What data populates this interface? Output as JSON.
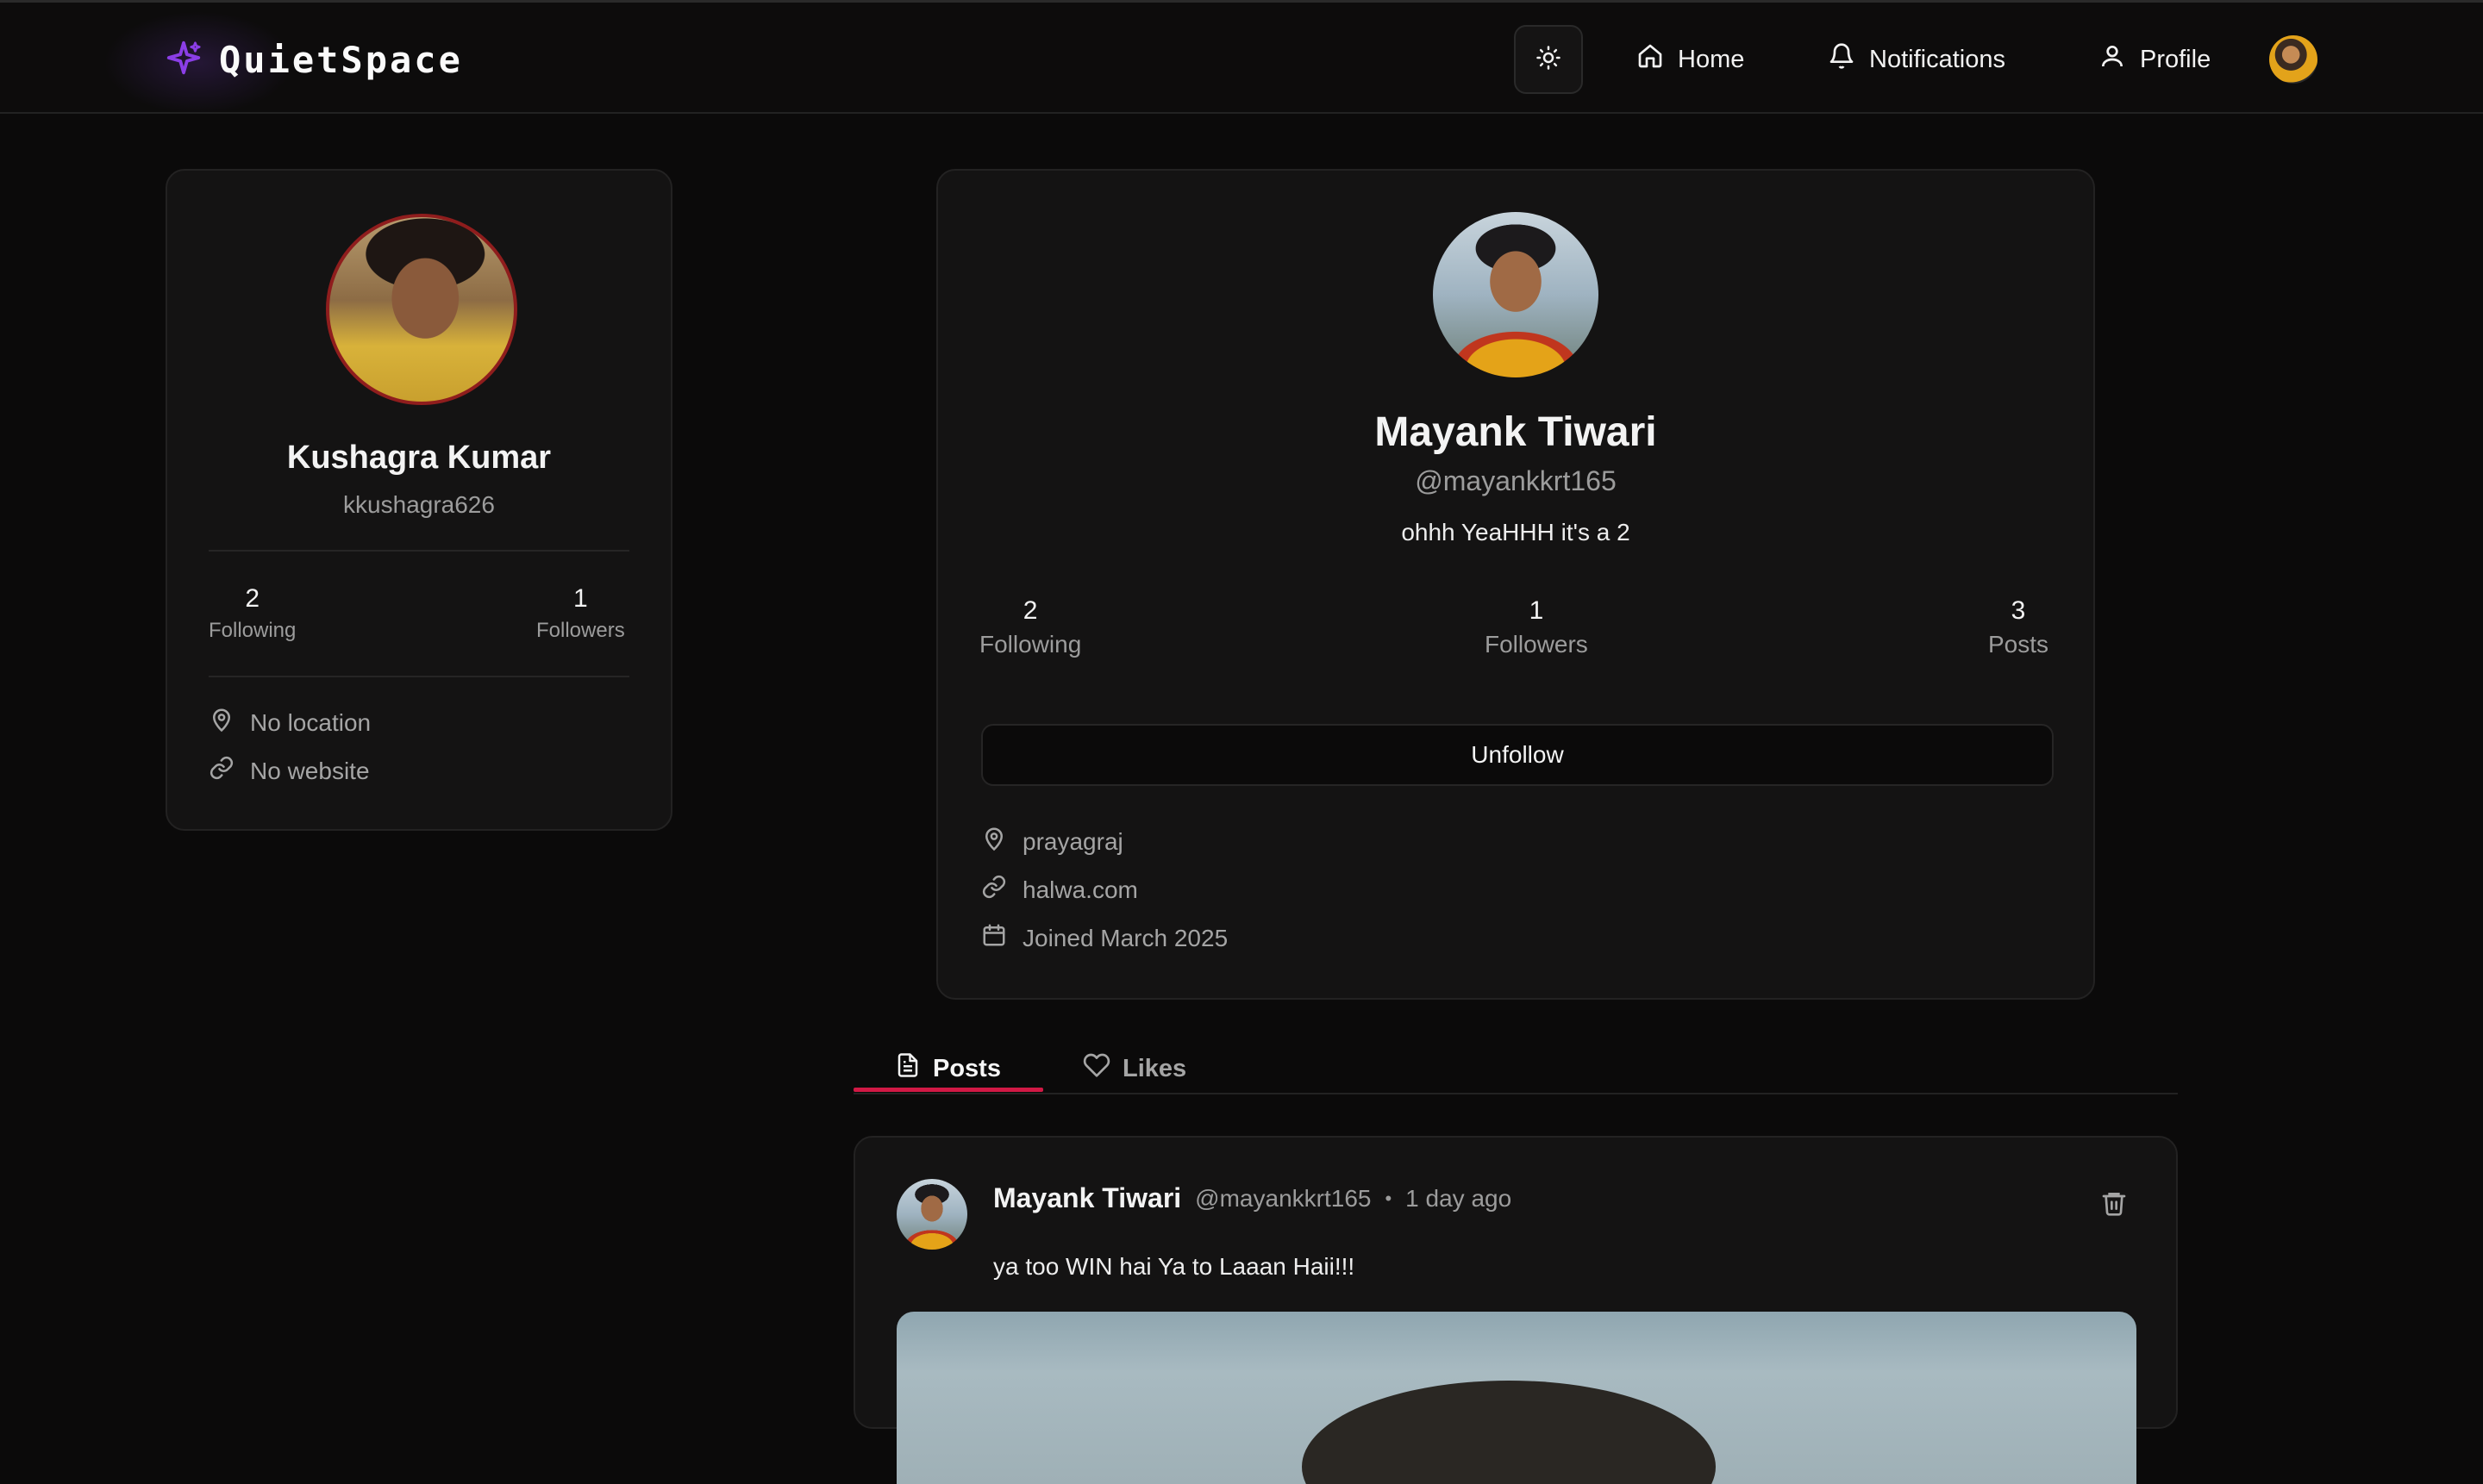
{
  "app": {
    "brand": "QuietSpace",
    "nav": [
      {
        "label": "Home",
        "icon": "home-icon"
      },
      {
        "label": "Notifications",
        "icon": "bell-icon"
      },
      {
        "label": "Profile",
        "icon": "user-icon"
      }
    ],
    "theme_icon": "sun-icon",
    "accent": "#d11945",
    "brand_color": "#8b3ee6"
  },
  "sidebar": {
    "name": "Kushagra Kumar",
    "username": "kkushagra626",
    "following_count": "2",
    "following_label": "Following",
    "followers_count": "1",
    "followers_label": "Followers",
    "location": "No location",
    "website": "No website"
  },
  "profile": {
    "name": "Mayank Tiwari",
    "handle": "@mayankkrt165",
    "bio": "ohhh YeaHHH it's a 2",
    "following_count": "2",
    "following_label": "Following",
    "followers_count": "1",
    "followers_label": "Followers",
    "posts_count": "3",
    "posts_label": "Posts",
    "unfollow_label": "Unfollow",
    "location": "prayagraj",
    "website": "halwa.com",
    "joined": "Joined March 2025"
  },
  "tabs": [
    {
      "label": "Posts",
      "active": true
    },
    {
      "label": "Likes",
      "active": false
    }
  ],
  "post": {
    "author": "Mayank Tiwari",
    "handle": "@mayankkrt165",
    "separator": "•",
    "time": "1 day ago",
    "content": "ya too WIN hai Ya to Laaan Haii!!!"
  }
}
